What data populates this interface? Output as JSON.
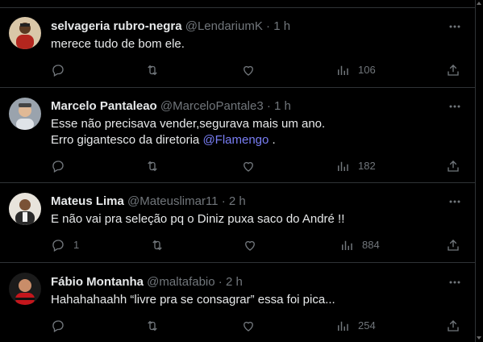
{
  "colors": {
    "background": "#000000",
    "text": "#e7e9ea",
    "muted": "#71767b",
    "mention": "#7a7ff6",
    "divider": "#2f3336"
  },
  "icons": {
    "reply": "reply-icon",
    "retweet": "retweet-icon",
    "like": "heart-icon",
    "views": "views-chart-icon",
    "share": "share-icon",
    "more": "more-dots-icon"
  },
  "tweets": [
    {
      "name": "selvageria rubro-negra",
      "handle": "@LendariumK",
      "time": "1 h",
      "lines": [
        "merece tudo de bom ele."
      ],
      "replies": "",
      "retweets": "",
      "likes": "",
      "views": "106"
    },
    {
      "name": "Marcelo Pantaleao",
      "handle": "@MarceloPantale3",
      "time": "1 h",
      "lines": [
        "Esse não precisava vender,segurava mais um ano."
      ],
      "line2_prefix": "Erro gigantesco da diretoria ",
      "line2_mention": "@Flamengo",
      "line2_suffix": " .",
      "replies": "",
      "retweets": "",
      "likes": "",
      "views": "182"
    },
    {
      "name": "Mateus Lima",
      "handle": "@Mateuslimar11",
      "time": "2 h",
      "lines": [
        "E não vai pra seleção pq o Diniz puxa saco do André !!"
      ],
      "replies": "1",
      "retweets": "",
      "likes": "",
      "views": "884"
    },
    {
      "name": "Fábio Montanha",
      "handle": "@maltafabio",
      "time": "2 h",
      "lines": [
        "Hahahahaahh “livre pra se consagrar” essa foi pica..."
      ],
      "replies": "",
      "retweets": "",
      "likes": "",
      "views": "254"
    }
  ],
  "separator": "·"
}
